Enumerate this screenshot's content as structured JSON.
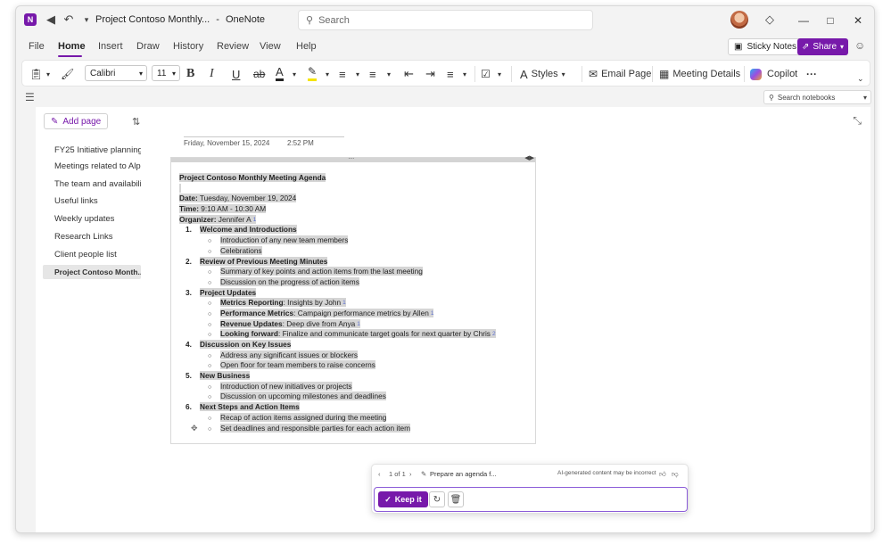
{
  "window": {
    "doc_title": "Project Contoso Monthly...",
    "app_name": "OneNote",
    "title_separator": "-",
    "search_placeholder": "Search"
  },
  "menu": {
    "items": [
      "File",
      "Home",
      "Insert",
      "Draw",
      "History",
      "Review",
      "View",
      "Help"
    ],
    "active": "Home",
    "sticky_notes": "Sticky Notes",
    "share": "Share"
  },
  "ribbon": {
    "font": "Calibri",
    "font_size": "11",
    "styles": "Styles",
    "email_page": "Email Page",
    "meeting_details": "Meeting Details",
    "copilot": "Copilot",
    "more": "···"
  },
  "search_notebooks": "Search notebooks",
  "pages": {
    "add_page": "Add page",
    "items": [
      "FY25 Initiative planning",
      "Meetings related to Alpha",
      "The team and availability",
      "Useful links",
      "Weekly updates",
      "Research Links",
      "Client people list",
      "Project Contoso Month..."
    ],
    "selected_index": 7
  },
  "page": {
    "date": "Friday, November 15, 2024",
    "time": "2:52 PM",
    "title": "Project Contoso Monthly Meeting Agenda",
    "date_label": "Date:",
    "date_value": " Tuesday, November 19, 2024",
    "time_label": "Time:",
    "time_value": " 9:10 AM - 10:30 AM",
    "organizer_label": "Organizer:",
    "organizer_value": " Jennifer A",
    "organizer_ref": "1",
    "sections": [
      {
        "num": "1.",
        "title": "Welcome and Introductions",
        "items": [
          {
            "text": "Introduction of any new team members"
          },
          {
            "text": "Celebrations"
          }
        ]
      },
      {
        "num": "2.",
        "title": "Review of Previous Meeting Minutes",
        "items": [
          {
            "text": "Summary of key points and action items from the last meeting"
          },
          {
            "text": "Discussion on the progress of action items"
          }
        ]
      },
      {
        "num": "3.",
        "title": "Project Updates",
        "items": [
          {
            "label": "Metrics Reporting",
            "text": ": Insights by John",
            "ref": "1"
          },
          {
            "label": "Performance Metrics",
            "text": ": Campaign performance metrics by Allen",
            "ref": "1"
          },
          {
            "label": "Revenue Updates",
            "text": ": Deep dive from Anya",
            "ref": "1"
          },
          {
            "label": "Looking forward",
            "text": ": Finalize and communicate target goals for next quarter by Chris",
            "ref": "2"
          }
        ]
      },
      {
        "num": "4.",
        "title": "Discussion on Key Issues",
        "items": [
          {
            "text": "Address any significant issues or blockers"
          },
          {
            "text": "Open floor for team members to raise concerns"
          }
        ]
      },
      {
        "num": "5.",
        "title": "New Business",
        "items": [
          {
            "text": "Introduction of new initiatives or projects"
          },
          {
            "text": "Discussion on upcoming milestones and deadlines"
          }
        ]
      },
      {
        "num": "6.",
        "title": "Next Steps and Action Items",
        "items": [
          {
            "text": "Recap of action items assigned during the meeting"
          },
          {
            "text": "Set deadlines and responsible parties for each action item"
          }
        ]
      }
    ]
  },
  "ai_panel": {
    "pager": "1 of 1",
    "prompt": "Prepare an agenda f...",
    "disclaimer": "AI-generated content may be incorrect",
    "keep": "Keep it"
  },
  "colors": {
    "accent": "#7719aa",
    "selection": "#d5d5d5"
  }
}
